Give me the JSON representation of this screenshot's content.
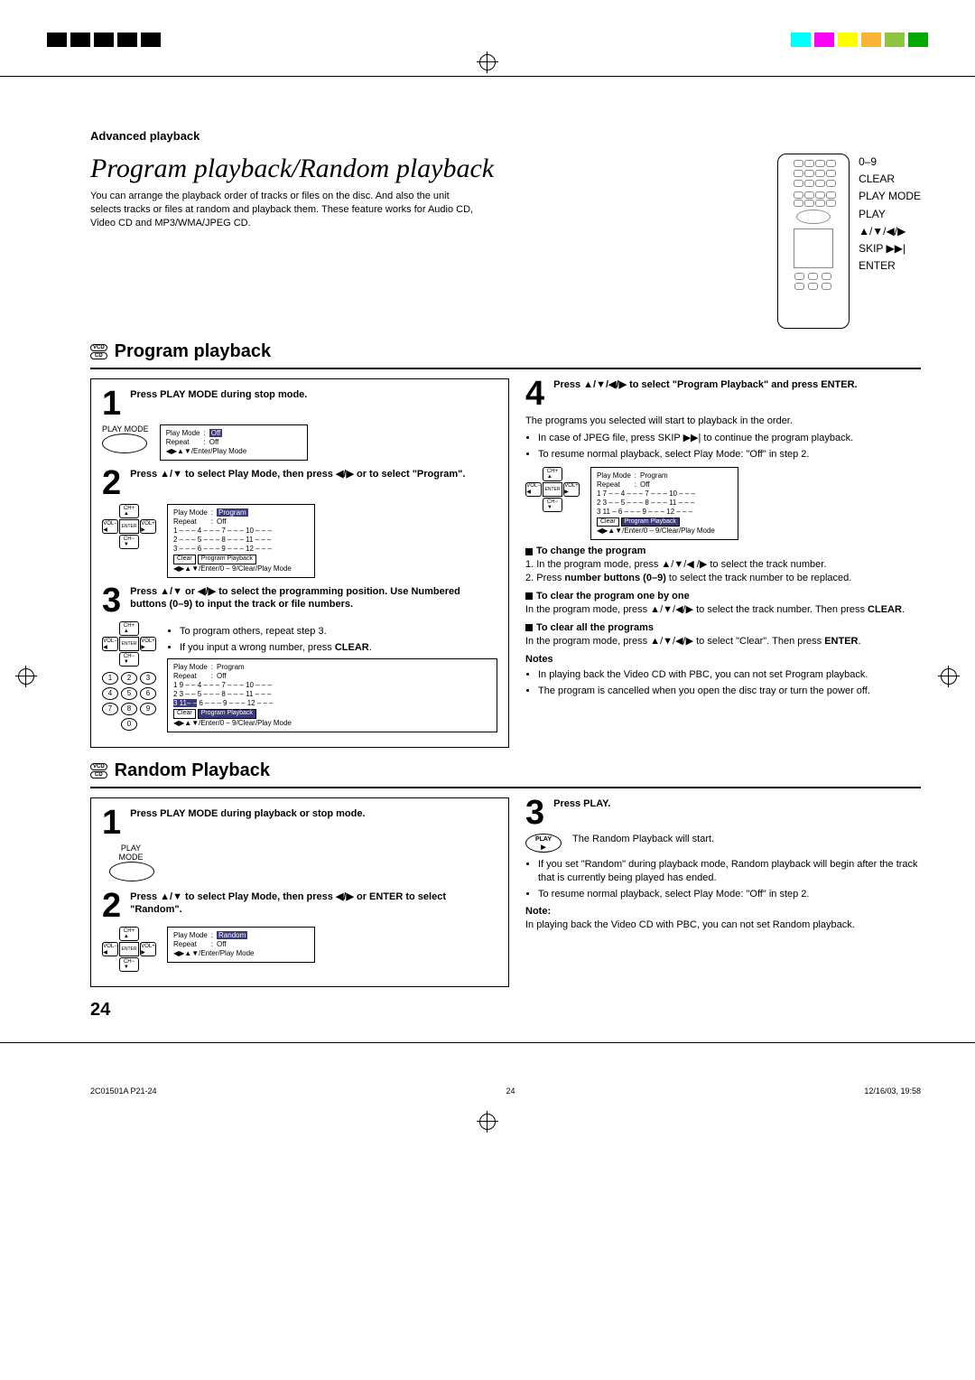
{
  "header": {
    "section": "Advanced playback",
    "title": "Program playback/Random playback",
    "intro": "You can arrange the playback order of tracks or files on the disc. And also the unit selects tracks or files at random and playback them. These feature works for Audio CD, Video CD and MP3/WMA/JPEG CD.",
    "remote_labels": [
      "0–9",
      "CLEAR",
      "PLAY MODE",
      "PLAY",
      "▲/▼/◀/▶",
      "SKIP ▶▶|",
      "ENTER"
    ]
  },
  "disc_badges": {
    "vcd": "VCD",
    "cd": "CD"
  },
  "program": {
    "heading": "Program playback",
    "steps": {
      "s1": {
        "text": "Press PLAY MODE during stop mode.",
        "btn": "PLAY MODE",
        "osd": {
          "mode": "Play Mode",
          "mode_val": "Off",
          "repeat": "Repeat",
          "repeat_val": "Off",
          "hint": "◀▶▲▼/Enter/Play Mode"
        }
      },
      "s2": {
        "text": "Press ▲/▼ to select Play Mode, then press ◀/▶ or to select \"Program\".",
        "nav": {
          "up": "CH+",
          "down": "CH−",
          "left": "VOL−",
          "right": "VOL+",
          "center": "ENTER"
        },
        "osd": {
          "mode": "Play Mode",
          "mode_val": "Program",
          "repeat": "Repeat",
          "repeat_val": "Off",
          "rows": [
            "1 – – –   4 – – –   7 – – –   10 – – –",
            "2 – – –   5 – – –   8 – – –   11 – – –",
            "3 – – –   6 – – –   9 – – –   12 – – –"
          ],
          "clear": "Clear",
          "pp": "Program Playback",
          "hint": "◀▶▲▼/Enter/0 – 9/Clear/Play Mode"
        }
      },
      "s3": {
        "text": "Press ▲/▼ or ◀/▶ to select the programming position. Use Numbered buttons (0–9) to input the track or file numbers.",
        "tips": [
          "To program others, repeat step 3.",
          "If you input a wrong number, press"
        ],
        "clear": "CLEAR",
        "osd": {
          "rows": [
            "1 9 – –   4 – – –   7 – – –   10 – – –",
            "2 3 – –   5 – – –   8 – – –   11 – – –",
            "3 11– –  6 – – –   9 – – –   12 – – –"
          ],
          "row_hi": "3 11– –",
          "clear": "Clear",
          "pp": "Program Playback",
          "hint": "◀▶▲▼/Enter/0 – 9/Clear/Play Mode"
        },
        "numpad": [
          "1",
          "2",
          "3",
          "4",
          "5",
          "6",
          "7",
          "8",
          "9",
          "0"
        ]
      },
      "s4": {
        "text": "Press ▲/▼/◀/▶ to select \"Program Playback\" and press ENTER.",
        "body1": "The programs you selected will start to playback in the order.",
        "bullets": [
          "In case of JPEG file, press SKIP ▶▶| to continue the program playback.",
          "To resume normal playback, select Play Mode: \"Off\" in step 2."
        ],
        "osd": {
          "rows": [
            "1 7 – –   4 – – –   7 – – –   10 – – –",
            "2 3 – –   5 – – –   8 – – –   11 – – –",
            "3 11 –   6 – – –   9 – – –   12 – – –"
          ],
          "clear": "Clear",
          "pp": "Program Playback",
          "hint": "◀▶▲▼/Enter/0 – 9/Clear/Play Mode"
        }
      }
    },
    "change": {
      "h": "To change the program",
      "l1": "1. In the program mode, press ▲/▼/◀ /▶ to select the track number.",
      "l2a": "2. Press ",
      "l2b": "number buttons (0–9)",
      "l2c": " to select the track number to be replaced."
    },
    "clear_one": {
      "h": "To clear the program one by one",
      "l1": "In the program mode, press ▲/▼/◀/▶ to select the track number. Then press ",
      "l1b": "CLEAR",
      "l1c": "."
    },
    "clear_all": {
      "h": "To clear all the programs",
      "l1": "In the program mode, press ▲/▼/◀/▶ to select \"Clear\". Then press ",
      "l1b": "ENTER",
      "l1c": "."
    },
    "notes_h": "Notes",
    "notes": [
      "In playing back the Video CD with PBC, you can not set Program playback.",
      "The program is cancelled when you open the disc tray or turn the power off."
    ]
  },
  "random": {
    "heading": "Random Playback",
    "s1": {
      "text": "Press PLAY MODE during playback or stop mode.",
      "btn": "PLAY MODE"
    },
    "s2": {
      "text": "Press ▲/▼ to select Play Mode, then press ◀/▶ or ENTER to select \"Random\".",
      "osd": {
        "mode": "Play Mode",
        "mode_val": "Random",
        "repeat": "Repeat",
        "repeat_val": "Off",
        "hint": "◀▶▲▼/Enter/Play Mode"
      }
    },
    "s3": {
      "text": "Press PLAY.",
      "play_label": "PLAY",
      "body": "The Random Playback will start.",
      "bullets": [
        "If you set \"Random\" during playback mode, Random playback will begin after the track that is currently being played has ended.",
        "To resume normal playback, select Play Mode: \"Off\" in step 2."
      ]
    },
    "note_h": "Note:",
    "note": "In playing back the Video CD with PBC, you can not set Random playback."
  },
  "page_num": "24",
  "footer": {
    "left": "2C01501A P21-24",
    "mid": "24",
    "right": "12/16/03, 19:58"
  },
  "color_bar": [
    "#000",
    "#000",
    "#000",
    "#000",
    "#000",
    "#fff",
    "#fff",
    "#fff",
    "#fff",
    "#fff",
    "#0ff",
    "#f0f",
    "#ff0",
    "#f9b233",
    "#8cc63e",
    "#0a0"
  ]
}
